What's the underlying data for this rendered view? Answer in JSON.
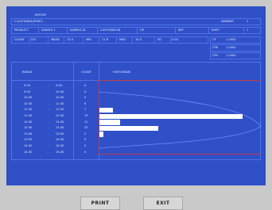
{
  "window": {
    "title": "REPORT"
  },
  "header": {
    "file_label": "C:\\LOT\\DATA\\(PORT)",
    "number_label": "NUMBER",
    "number_value": "1",
    "row2": [
      "PRODUCT",
      "SAMPLE 1",
      "SAMPLE-ID",
      "CUSTOMER-ID",
      "OP",
      "REF",
      "SHIFT",
      "1"
    ],
    "row3": [
      "COUNT",
      "150",
      "MEAN",
      "13.4",
      "MIN",
      "11.6",
      "MAX",
      "15.0",
      "SD",
      "0.50"
    ]
  },
  "stats": [
    {
      "label": "CP",
      "value": "1.0000"
    },
    {
      "label": "CPK",
      "value": "1.0000"
    },
    {
      "label": "CPU",
      "value": "1.0000"
    }
  ],
  "table": {
    "range_header": "RANGE",
    "count_header": "COUNT",
    "hist_header": "HISTOGRAM",
    "rows": [
      {
        "from": "9.00",
        "to": "9.50",
        "count": "0"
      },
      {
        "from": "9.50",
        "to": "10.00",
        "count": "0"
      },
      {
        "from": "10.00",
        "to": "10.50",
        "count": "0"
      },
      {
        "from": "10.50",
        "to": "11.00",
        "count": "0"
      },
      {
        "from": "11.00",
        "to": "11.50",
        "count": "7"
      },
      {
        "from": "11.50",
        "to": "12.00",
        "count": "75"
      },
      {
        "from": "12.00",
        "to": "12.50",
        "count": "11"
      },
      {
        "from": "12.50",
        "to": "13.00",
        "count": "31"
      },
      {
        "from": "13.00",
        "to": "13.50",
        "count": "2"
      },
      {
        "from": "13.50",
        "to": "14.00",
        "count": "0"
      },
      {
        "from": "14.00",
        "to": "14.50",
        "count": "0"
      },
      {
        "from": "14.50",
        "to": "15.00",
        "count": "0"
      }
    ]
  },
  "histogram": {
    "max_count": 75
  },
  "buttons": {
    "print": "PRINT",
    "exit": "EXIT"
  }
}
